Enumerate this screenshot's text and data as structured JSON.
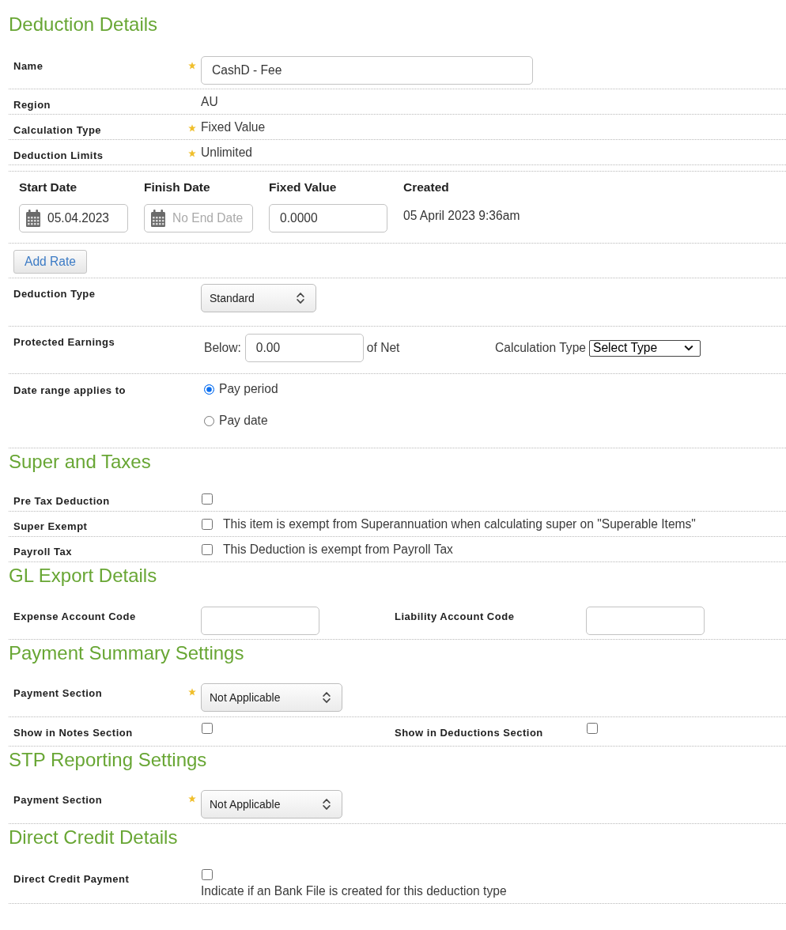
{
  "sections": [
    {
      "title": "Deduction Details",
      "rows": [
        {
          "kind": "text",
          "label": "Name",
          "required": true,
          "value": "CashD - Fee"
        },
        {
          "kind": "static",
          "label": "Region",
          "required": false,
          "value": "AU"
        },
        {
          "kind": "static",
          "label": "Calculation Type",
          "required": true,
          "value": "Fixed Value"
        },
        {
          "kind": "static",
          "label": "Deduction Limits",
          "required": true,
          "value": "Unlimited"
        },
        {
          "kind": "rates",
          "headers": [
            "Start Date",
            "Finish Date",
            "Fixed Value",
            "Created"
          ],
          "dates": [
            {
              "value": "05.04.2023"
            },
            {
              "placeholder": "No End Date"
            }
          ],
          "fixed_value": "0.0000",
          "created": "05 April 2023 9:36am"
        },
        {
          "kind": "button",
          "label": "Add Rate"
        },
        {
          "kind": "select",
          "label": "Deduction Type",
          "required": false,
          "value": "Standard"
        },
        {
          "kind": "protected",
          "label": "Protected Earnings",
          "below": {
            "label": "Below:",
            "value": "0.00",
            "suffix": "of Net"
          },
          "calculation": {
            "label": "Calculation Type",
            "value": "Select Type"
          }
        },
        {
          "kind": "radio",
          "label": "Date range applies to",
          "options": [
            {
              "label": "Pay period",
              "selected": true
            },
            {
              "label": "Pay date",
              "selected": false
            }
          ]
        }
      ]
    },
    {
      "title": "Super and Taxes",
      "rows": [
        {
          "kind": "checkbox",
          "label": "Pre Tax Deduction",
          "checked": false
        },
        {
          "kind": "checkbox",
          "label": "Super Exempt",
          "checked": false,
          "description": "This item is exempt from Superannuation when calculating super on \"Superable Items\""
        },
        {
          "kind": "checkbox",
          "label": "Payroll Tax",
          "checked": false,
          "description": "This Deduction is exempt from Payroll Tax"
        }
      ]
    },
    {
      "title": "GL Export Details",
      "rows": [
        {
          "kind": "input_pair",
          "fields": [
            {
              "label": "Expense Account Code"
            },
            {
              "label": "Liability Account Code"
            }
          ]
        }
      ]
    },
    {
      "title": "Payment Summary Settings",
      "rows": [
        {
          "kind": "select",
          "label": "Payment Section",
          "required": true,
          "value": "Not Applicable"
        },
        {
          "kind": "checkbox_pair",
          "fields": [
            {
              "label": "Show in Notes Section",
              "checked": false
            },
            {
              "label": "Show in Deductions Section",
              "checked": false
            }
          ]
        }
      ]
    },
    {
      "title": "STP Reporting Settings",
      "rows": [
        {
          "kind": "select",
          "label": "Payment Section",
          "required": true,
          "value": "Not Applicable"
        }
      ]
    },
    {
      "title": "Direct Credit Details",
      "rows": [
        {
          "kind": "checkbox_note",
          "label": "Direct Credit Payment",
          "checked": false,
          "description": "Indicate if an Bank File is created for this deduction type"
        }
      ]
    }
  ]
}
